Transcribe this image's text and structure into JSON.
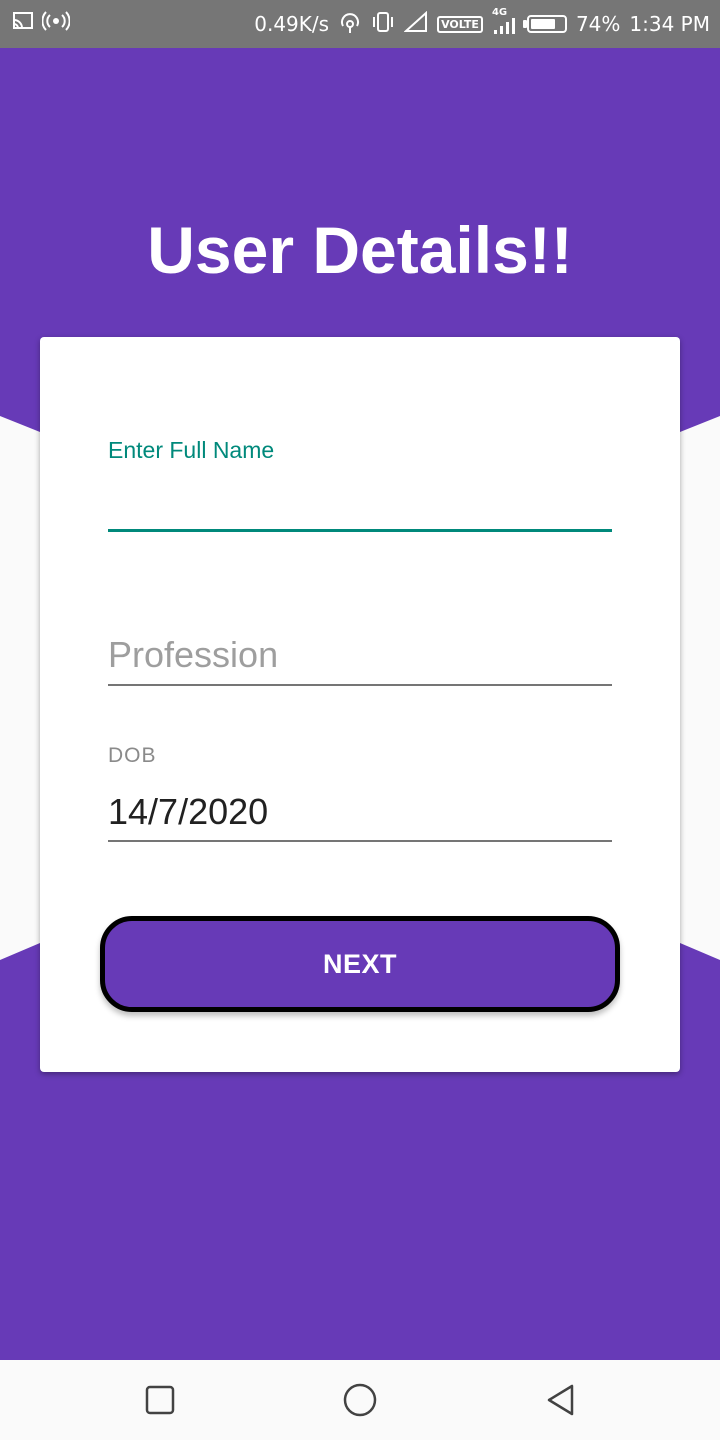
{
  "status_bar": {
    "speed": "0.49K/s",
    "volte": "VOLTE",
    "network": "4G",
    "battery": "74%",
    "battery_level": 0.74,
    "time": "1:34 PM"
  },
  "page": {
    "title": "User Details!!"
  },
  "form": {
    "full_name": {
      "label": "Enter Full Name",
      "value": ""
    },
    "profession": {
      "placeholder": "Profession",
      "value": ""
    },
    "dob": {
      "label": "DOB",
      "value": "14/7/2020"
    },
    "next_label": "NEXT"
  },
  "colors": {
    "primary": "#673ab7",
    "accent": "#00897b",
    "status_bar": "#767676"
  },
  "nav": {
    "icons": [
      "recents-icon",
      "home-icon",
      "back-icon"
    ]
  }
}
